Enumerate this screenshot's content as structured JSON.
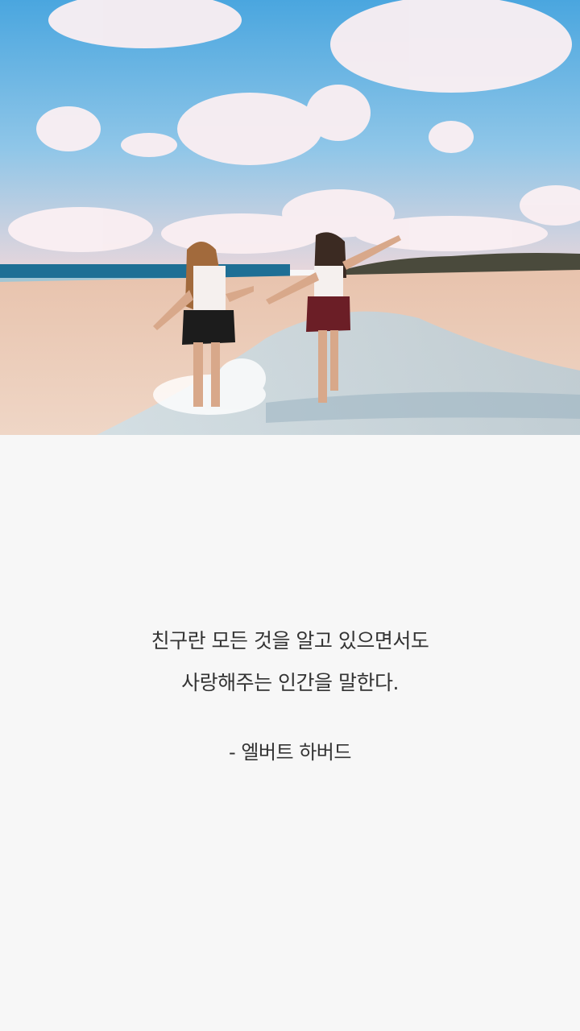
{
  "quote": {
    "lines": [
      "친구란 모든 것을 알고 있으면서도",
      "사랑해주는 인간을 말한다."
    ],
    "author": "- 엘버트 하버드"
  },
  "colors": {
    "background": "#f7f7f7",
    "text": "#333333",
    "sky": "#5aaee0",
    "sand": "#e9c8b0"
  },
  "photo": {
    "subject": "beach-photo"
  }
}
